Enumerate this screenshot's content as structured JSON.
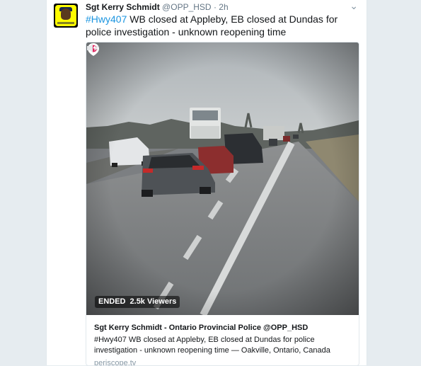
{
  "tweet": {
    "author_name": "Sgt Kerry Schmidt",
    "handle": "@OPP_HSD",
    "separator": "·",
    "time": "2h",
    "hashtag": "#Hwy407",
    "text": " WB closed at Appleby, EB closed at Dundas for police investigation - unknown reopening time"
  },
  "video": {
    "status_label": "ENDED",
    "viewers": "2.5k Viewers"
  },
  "card": {
    "title": "Sgt Kerry Schmidt - Ontario Provincial Police @OPP_HSD",
    "description": "#Hwy407 WB closed at Appleby, EB closed at Dundas for police investigation - unknown reopening time — Oakville, Ontario, Canada",
    "domain": "periscope.tv"
  },
  "icons": {
    "caret": "chevron-down-icon",
    "periscope": "periscope-icon",
    "mute": "speaker-muted-icon"
  },
  "colors": {
    "link": "#1b95e0",
    "periscope_red": "#e0245e",
    "text": "#14171a",
    "muted": "#657786"
  }
}
